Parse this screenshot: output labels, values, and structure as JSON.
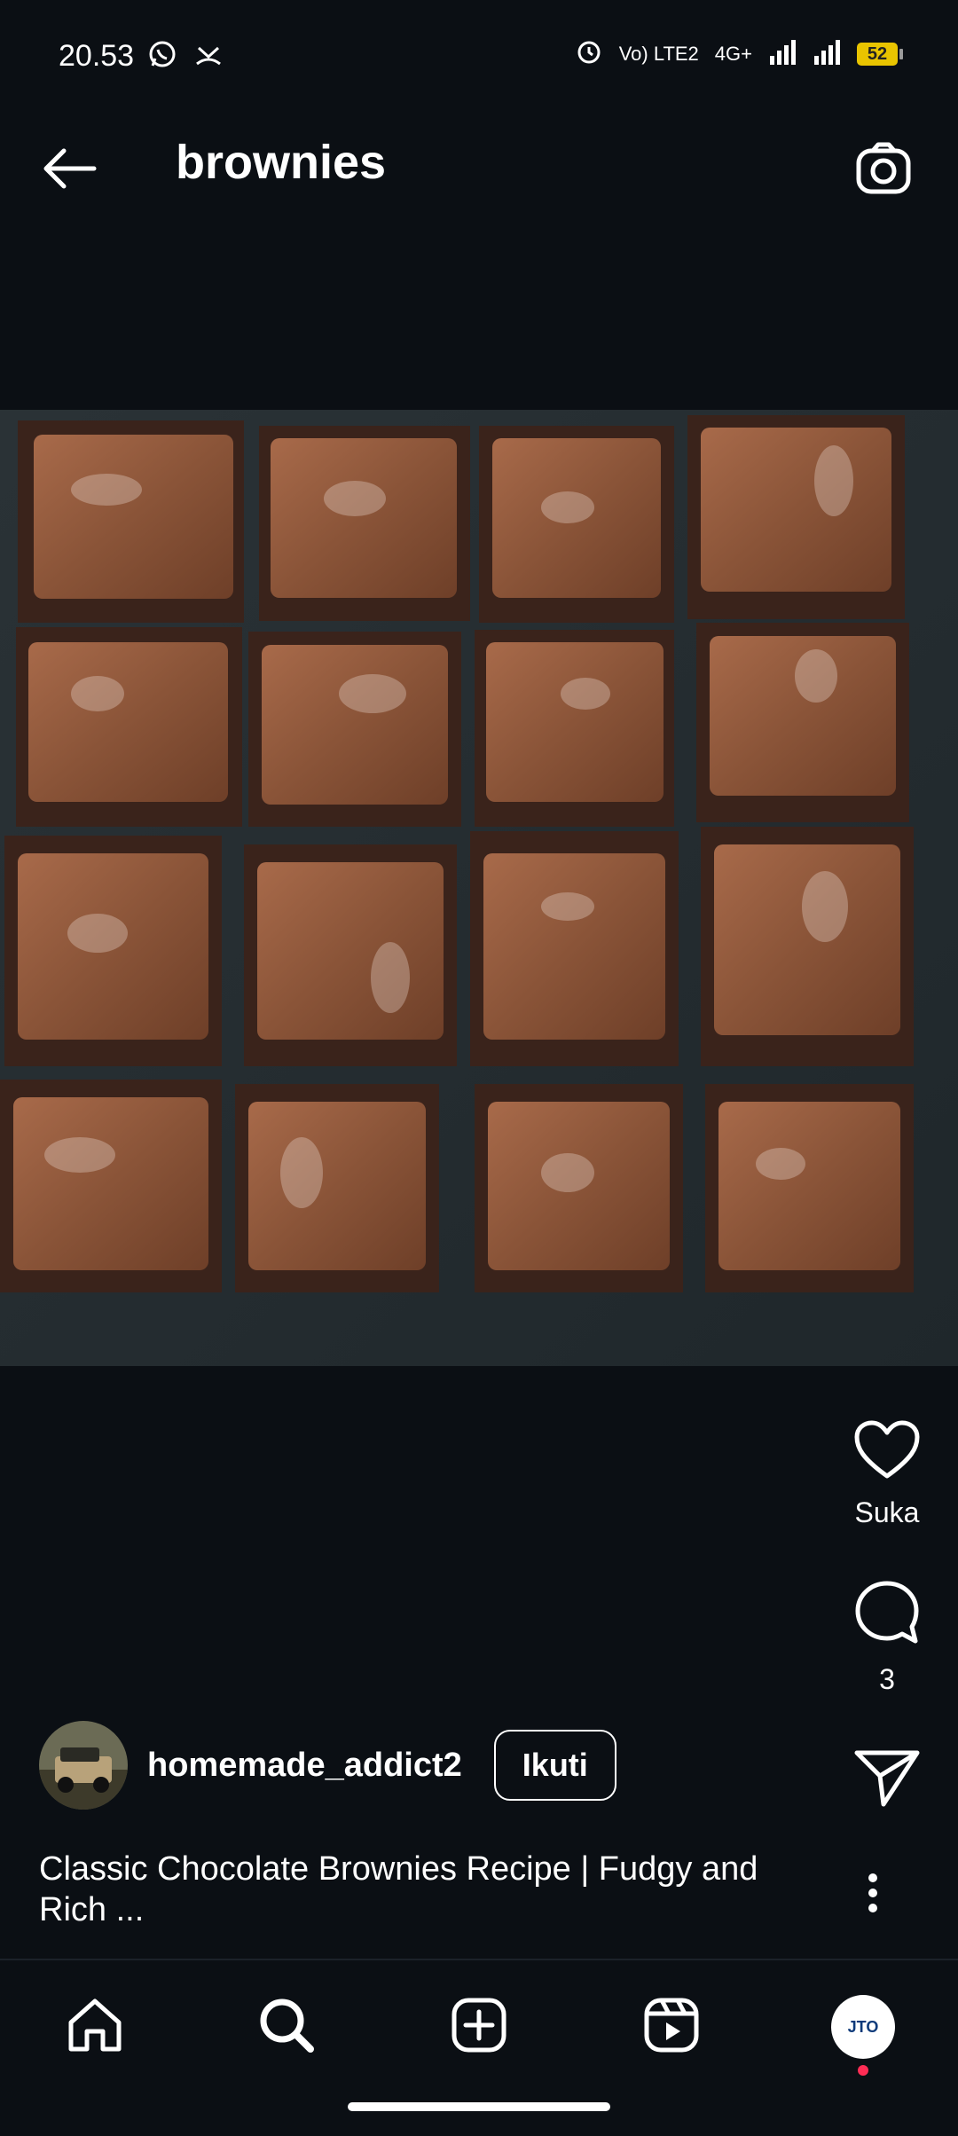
{
  "status_bar": {
    "time": "20.53",
    "network": "4G+",
    "volte": "Vo) LTE2",
    "battery": "52",
    "left_icons": [
      "whatsapp-icon",
      "missed-call-icon"
    ],
    "right_icons": [
      "alarm-icon",
      "volte-icon",
      "signal-icon",
      "signal-icon",
      "battery-icon"
    ]
  },
  "header": {
    "title": "brownies",
    "back_icon": "arrow-left-icon",
    "camera_icon": "camera-icon"
  },
  "post": {
    "media_description_icon": "photo",
    "username": "homemade_addict2",
    "follow_label": "Ikuti",
    "caption": "Classic Chocolate Brownies Recipe | Fudgy and Rich ...",
    "like_label": "Suka",
    "comment_count": "3"
  },
  "bottom_nav": {
    "items": [
      "home-icon",
      "search-icon",
      "create-icon",
      "reels-icon",
      "profile-icon"
    ],
    "profile_text": "JTO"
  },
  "colors": {
    "background": "#0b0f14",
    "text": "#ffffff",
    "battery": "#e9c400",
    "notification": "#ff2d55"
  }
}
